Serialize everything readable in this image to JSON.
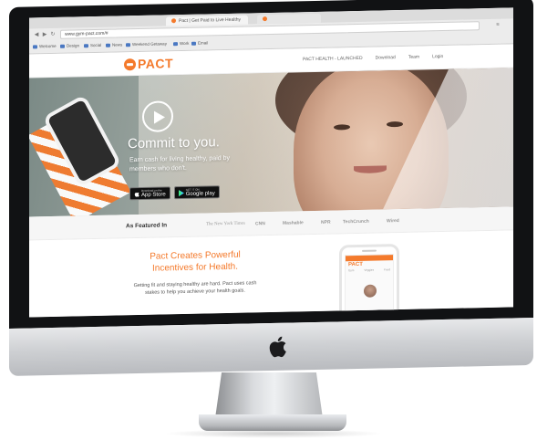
{
  "browser": {
    "tabs": [
      {
        "label": "Pact | Get Paid to Live Healthy"
      },
      {
        "label": ""
      }
    ],
    "address": "www.gym-pact.com/#",
    "bookmarks": [
      "Welcome",
      "Design",
      "Social",
      "News",
      "Weekend Getaway",
      "Work",
      "Email"
    ]
  },
  "site": {
    "logo": "PACT",
    "nav": [
      "PACT HEALTH - LAUNCHED",
      "Download",
      "Team",
      "Login"
    ]
  },
  "hero": {
    "title": "Commit to you.",
    "subtitle": "Earn cash for living healthy, paid by members who don't.",
    "app_store_small": "Download on the",
    "app_store_big": "App Store",
    "google_small": "GET IT ON",
    "google_big": "Google play"
  },
  "featured": {
    "label": "As Featured In",
    "press": [
      "The New York Times",
      "CNN",
      "Mashable",
      "NPR",
      "TechCrunch",
      "Wired"
    ]
  },
  "content": {
    "title": "Pact Creates Powerful Incentives for Health.",
    "body": "Getting fit and staying healthy are hard. Pact uses cash stakes to help you achieve your health goals."
  },
  "app_preview": {
    "logo": "PACT",
    "labels": [
      "Gym",
      "Veggies",
      "Food"
    ]
  },
  "colors": {
    "brand": "#f47a2c",
    "bezel": "#111214",
    "chin": "#cfd1d4"
  },
  "icons": {
    "apple": "apple-logo-icon",
    "play": "play-icon"
  }
}
